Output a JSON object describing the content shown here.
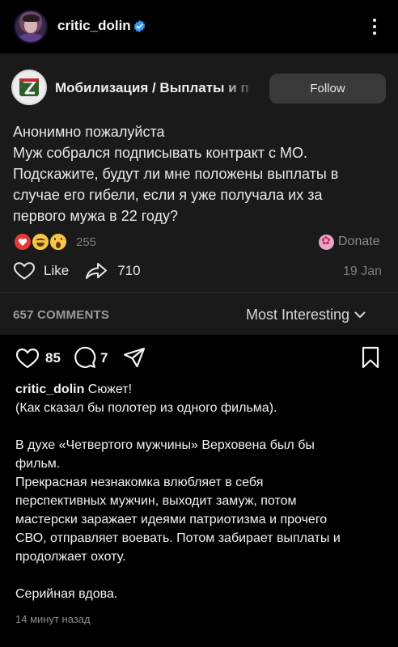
{
  "header": {
    "username": "critic_dolin",
    "icons": {
      "verified": "verified-badge-icon",
      "more": "more-options-icon"
    },
    "verified_color": "#3897f0"
  },
  "embed": {
    "channel_name": "Мобилизация / Выплаты и п",
    "follow_label": "Follow",
    "text_lines": [
      "Анонимно пожалуйста",
      "Муж собрался подписывать контракт с МО.",
      "Подскажите, будут ли мне положены выплаты в",
      "случае его гибели, если я уже получала их за",
      "первого мужа в 22 году?"
    ],
    "reactions": {
      "icons": [
        "heart-reaction-icon",
        "laughing-reaction-icon",
        "surprised-reaction-icon"
      ],
      "count": "255"
    },
    "donate_label": "Donate",
    "like_label": "Like",
    "share_count": "710",
    "date": "19 Jan",
    "comments_label": "657 COMMENTS",
    "sort_label": "Most Interesting",
    "background": "#1a1a1a"
  },
  "actions": {
    "likes": "85",
    "comments": "7",
    "icons": [
      "heart-icon",
      "comment-icon",
      "send-icon",
      "bookmark-icon"
    ]
  },
  "caption": {
    "username": "critic_dolin",
    "first_line_text": " Сюжет!",
    "lines": [
      "(Как сказал бы полотер из одного фильма).",
      "",
      "В духе «Четвертого мужчины» Верховена был бы",
      "фильм.",
      "Прекрасная незнакомка влюбляет в себя",
      "перспективных мужчин, выходит замуж, потом",
      "мастерски заражает идеями патриотизма и прочего",
      "СВО, отправляет воевать. Потом забирает выплаты и",
      "продолжает охоту.",
      "",
      "Серийная вдова."
    ],
    "timestamp": "14 минут назад"
  }
}
